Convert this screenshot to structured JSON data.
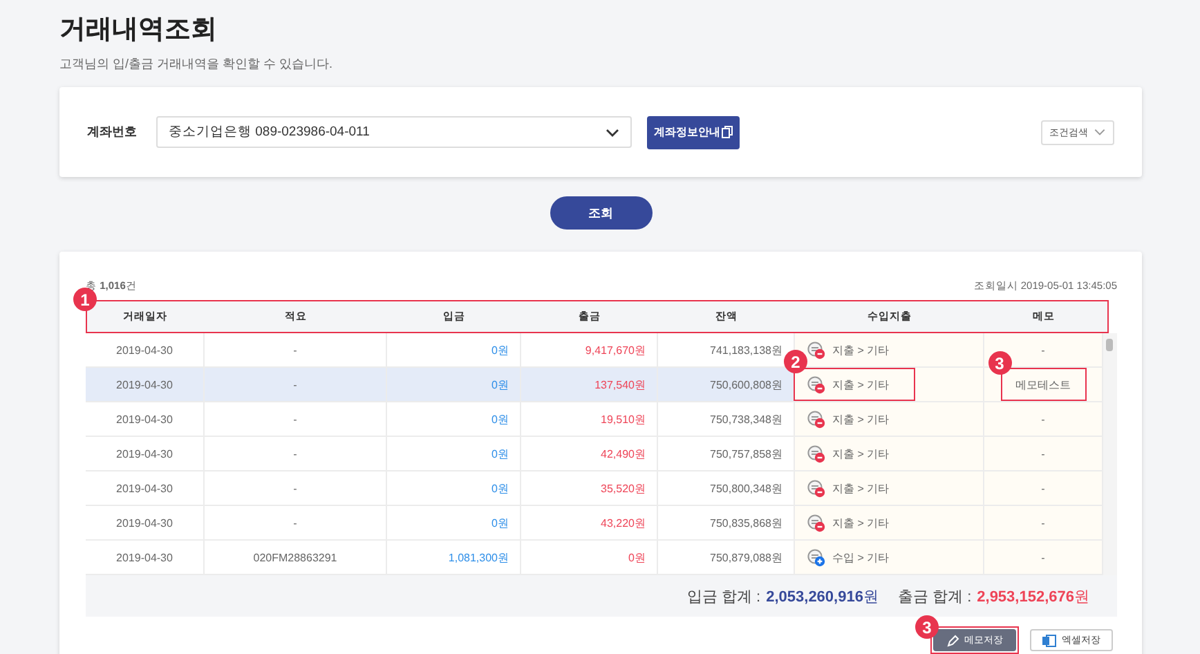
{
  "page": {
    "title": "거래내역조회",
    "subtitle": "고객님의 입/출금 거래내역을 확인할 수 있습니다."
  },
  "search": {
    "account_label": "계좌번호",
    "account_value": "중소기업은행 089-023986-04-011",
    "info_button": "계좌정보안내",
    "condition_button": "조건검색"
  },
  "query_button": "조회",
  "results": {
    "total": "총 **1,016**건",
    "query_time": "조회일시 2019-05-01 13:45:05",
    "header_callout": "1",
    "columns": [
      "거래일자",
      "적요",
      "입금",
      "출금",
      "잔액",
      "수입지출",
      "메모"
    ],
    "rows": [
      {
        "date": "2019-04-30",
        "description": "-",
        "deposit": "0원",
        "withdrawal": "9,417,670원",
        "balance": "741,183,138원",
        "category": {
          "kind": "expense",
          "label": "지출 > 기타"
        },
        "memo": {
          "text": "-"
        },
        "selected": false
      },
      {
        "date": "2019-04-30",
        "description": "-",
        "deposit": "0원",
        "withdrawal": "137,540원",
        "balance": "750,600,808원",
        "category": {
          "kind": "expense",
          "label": "지출 > 기타",
          "callout": "2"
        },
        "memo": {
          "text": "메모테스트",
          "callout": "3"
        },
        "selected": true
      },
      {
        "date": "2019-04-30",
        "description": "-",
        "deposit": "0원",
        "withdrawal": "19,510원",
        "balance": "750,738,348원",
        "category": {
          "kind": "expense",
          "label": "지출 > 기타"
        },
        "memo": {
          "text": "-"
        },
        "selected": false
      },
      {
        "date": "2019-04-30",
        "description": "-",
        "deposit": "0원",
        "withdrawal": "42,490원",
        "balance": "750,757,858원",
        "category": {
          "kind": "expense",
          "label": "지출 > 기타"
        },
        "memo": {
          "text": "-"
        },
        "selected": false
      },
      {
        "date": "2019-04-30",
        "description": "-",
        "deposit": "0원",
        "withdrawal": "35,520원",
        "balance": "750,800,348원",
        "category": {
          "kind": "expense",
          "label": "지출 > 기타"
        },
        "memo": {
          "text": "-"
        },
        "selected": false
      },
      {
        "date": "2019-04-30",
        "description": "-",
        "deposit": "0원",
        "withdrawal": "43,220원",
        "balance": "750,835,868원",
        "category": {
          "kind": "expense",
          "label": "지출 > 기타"
        },
        "memo": {
          "text": "-"
        },
        "selected": false
      },
      {
        "date": "2019-04-30",
        "description": "020FM28863291",
        "deposit": "1,081,300원",
        "withdrawal": "0원",
        "balance": "750,879,088원",
        "category": {
          "kind": "income",
          "label": "수입 > 기타"
        },
        "memo": {
          "text": "-"
        },
        "selected": false
      }
    ],
    "totals": [
      {
        "label": "입금 합계 :",
        "amount": "**2,053,260,916**원",
        "kind": "deposit"
      },
      {
        "label": "출금 합계 :",
        "amount": "**2,953,152,676**원",
        "kind": "withdrawal"
      }
    ],
    "buttons": [
      {
        "label": "메모저장",
        "kind": "memo",
        "callout": "3"
      },
      {
        "label": "엑셀저장",
        "kind": "excel"
      }
    ]
  }
}
